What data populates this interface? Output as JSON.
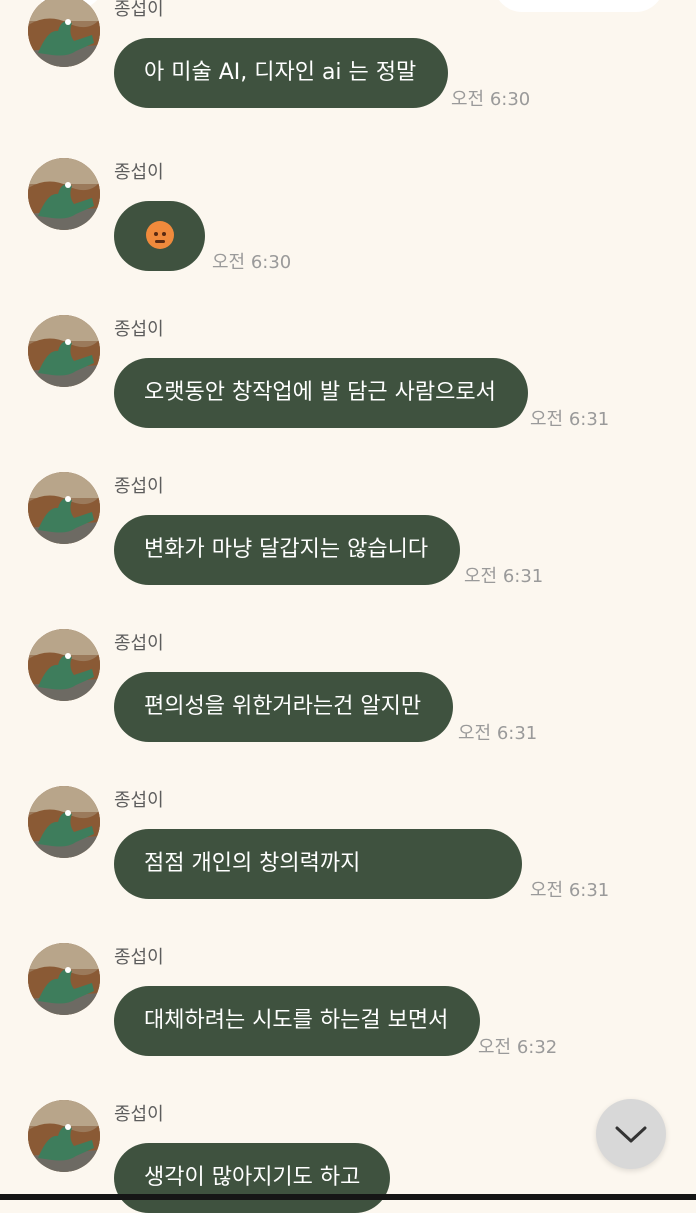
{
  "messages": [
    {
      "sender": "종섭이",
      "text": "아 미술 AI, 디자인 ai 는 정말",
      "time": "오전 6:30",
      "emoji": ""
    },
    {
      "sender": "종섭이",
      "text": "",
      "time": "오전 6:30",
      "emoji": "angry-face"
    },
    {
      "sender": "종섭이",
      "text": "오랫동안 창작업에 발 담근 사람으로서",
      "time": "오전 6:31",
      "emoji": ""
    },
    {
      "sender": "종섭이",
      "text": "변화가 마냥 달갑지는 않습니다",
      "time": "오전 6:31",
      "emoji": ""
    },
    {
      "sender": "종섭이",
      "text": "편의성을 위한거라는건 알지만",
      "time": "오전 6:31",
      "emoji": ""
    },
    {
      "sender": "종섭이",
      "text": "점점 개인의 창의력까지",
      "time": "오전 6:31",
      "emoji": ""
    },
    {
      "sender": "종섭이",
      "text": "대체하려는 시도를 하는걸 보면서",
      "time": "오전 6:32",
      "emoji": ""
    },
    {
      "sender": "종섭이",
      "text": "생각이 많아지기도 하고",
      "time": "",
      "emoji": ""
    }
  ],
  "scroll_button": {
    "icon": "chevron-down-icon"
  },
  "colors": {
    "background": "#fcf7ef",
    "bubble": "#3f523f",
    "bubble_text": "#ffffff"
  }
}
